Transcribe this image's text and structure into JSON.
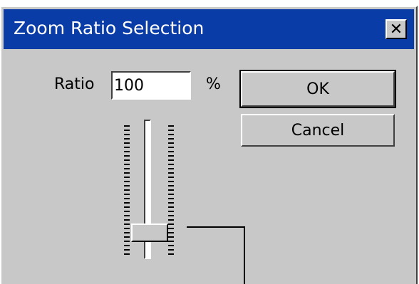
{
  "window": {
    "title": "Zoom Ratio Selection",
    "close_glyph": "✕",
    "close_icon": "close-icon"
  },
  "ratio": {
    "label": "Ratio",
    "value": "100",
    "unit": "%"
  },
  "buttons": {
    "ok": "OK",
    "cancel": "Cancel"
  },
  "slider": {
    "level": 0.86
  },
  "colors": {
    "titlebar": "#0a3ca8",
    "face": "#c8c8c8"
  }
}
